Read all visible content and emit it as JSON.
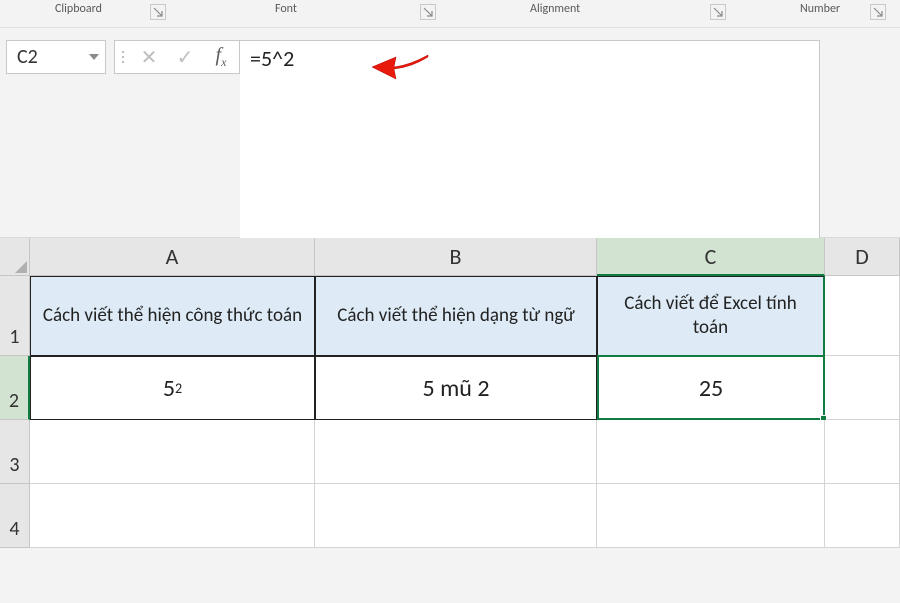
{
  "ribbon": {
    "groups": [
      "Clipboard",
      "Font",
      "Alignment",
      "Number"
    ]
  },
  "namebox": {
    "value": "C2"
  },
  "formula_bar": {
    "buttons": {
      "cancel": "✕",
      "enter": "✓",
      "fx": "fx"
    },
    "value": "=5^2"
  },
  "columns": [
    "A",
    "B",
    "C",
    "D"
  ],
  "rows": [
    "1",
    "2",
    "3",
    "4"
  ],
  "selected_column": "C",
  "selected_row": "2",
  "table": {
    "headers": {
      "A": "Cách viết thể hiện công thức toán",
      "B": "Cách viết thể hiện dạng từ ngữ",
      "C": "Cách viết để Excel tính toán"
    },
    "row2": {
      "A_base": "5",
      "A_exp": "2",
      "B": "5 mũ 2",
      "C": "25"
    }
  }
}
